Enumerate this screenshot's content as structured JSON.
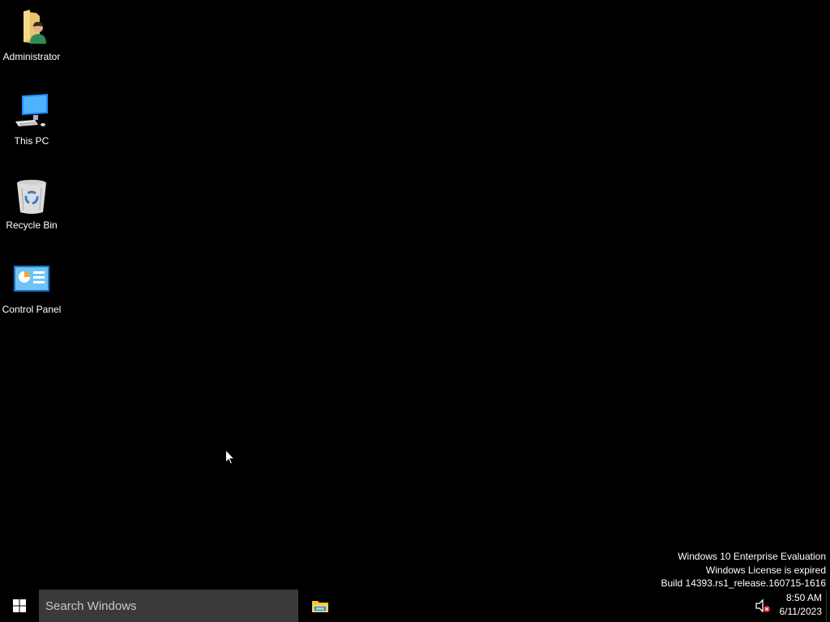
{
  "desktop": {
    "icons": [
      {
        "label": "Administrator",
        "icon": "user-folder-icon"
      },
      {
        "label": "This PC",
        "icon": "computer-icon"
      },
      {
        "label": "Recycle Bin",
        "icon": "recycle-bin-icon"
      },
      {
        "label": "Control Panel",
        "icon": "control-panel-icon"
      }
    ],
    "watermark": {
      "line1": "Windows 10 Enterprise Evaluation",
      "line2": "Windows License is expired",
      "line3": "Build 14393.rs1_release.160715-1616"
    }
  },
  "taskbar": {
    "start_icon": "windows-logo-icon",
    "search_placeholder": "Search Windows",
    "pinned": [
      {
        "icon": "file-explorer-icon"
      }
    ],
    "tray": {
      "volume_icon": "volume-muted-icon"
    },
    "clock": {
      "time": "8:50 AM",
      "date": "6/11/2023"
    }
  },
  "colors": {
    "background": "#000000",
    "search_bg": "#3a3a3a",
    "windows_blue": "#ffffff"
  }
}
